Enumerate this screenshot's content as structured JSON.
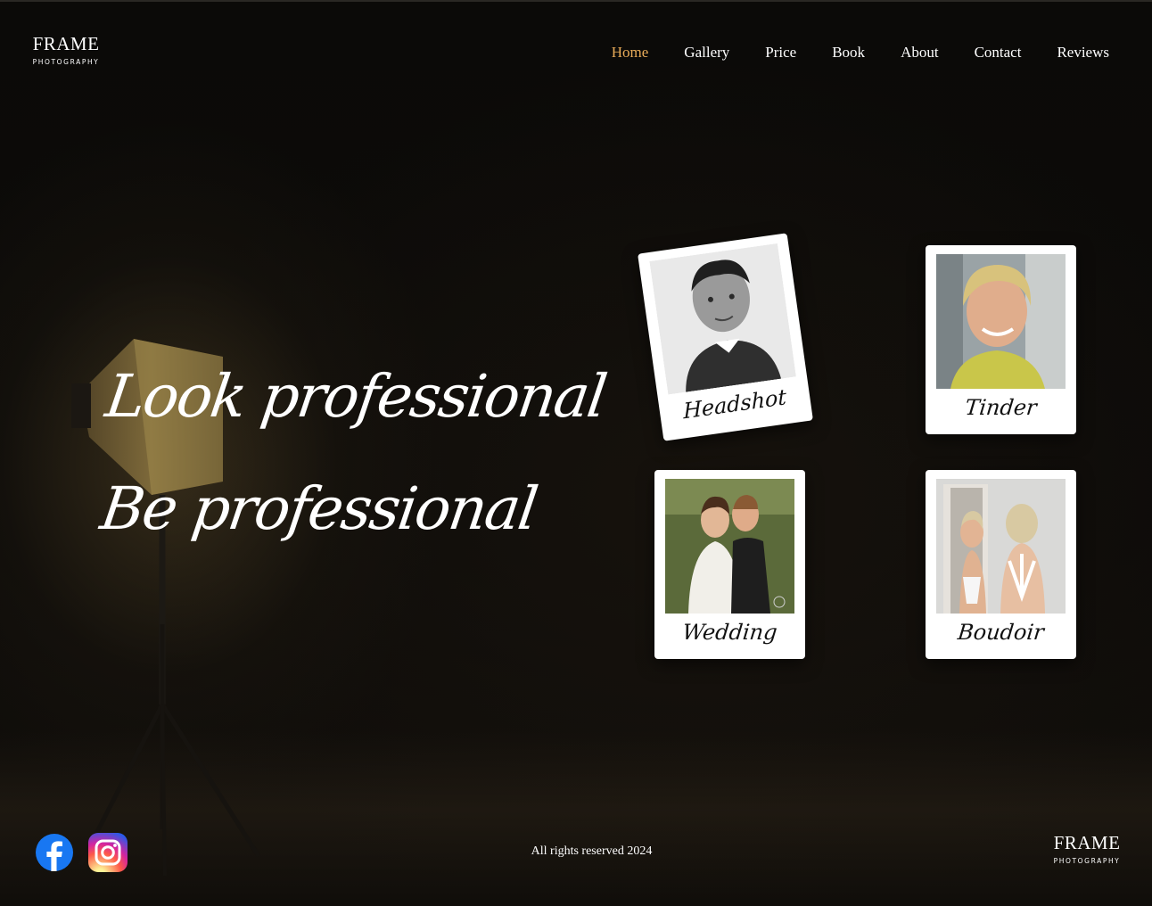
{
  "brand": {
    "name": "FRAME",
    "tagline": "PHOTOGRAPHY"
  },
  "nav": {
    "items": [
      {
        "label": "Home",
        "active": true
      },
      {
        "label": "Gallery",
        "active": false
      },
      {
        "label": "Price",
        "active": false
      },
      {
        "label": "Book",
        "active": false
      },
      {
        "label": "About",
        "active": false
      },
      {
        "label": "Contact",
        "active": false
      },
      {
        "label": "Reviews",
        "active": false
      }
    ],
    "active_color": "#e8ab58"
  },
  "hero": {
    "line1": "Look professional",
    "line2": "Be professional"
  },
  "cards": [
    {
      "caption": "Headshot",
      "icon": "headshot-photo"
    },
    {
      "caption": "Tinder",
      "icon": "portrait-photo"
    },
    {
      "caption": "Wedding",
      "icon": "wedding-photo"
    },
    {
      "caption": "Boudoir",
      "icon": "boudoir-photo"
    }
  ],
  "footer": {
    "copyright": "All rights reserved 2024",
    "social": [
      {
        "icon": "facebook-icon",
        "color": "#1877f2"
      },
      {
        "icon": "instagram-icon",
        "color": "#d6249f"
      }
    ]
  }
}
